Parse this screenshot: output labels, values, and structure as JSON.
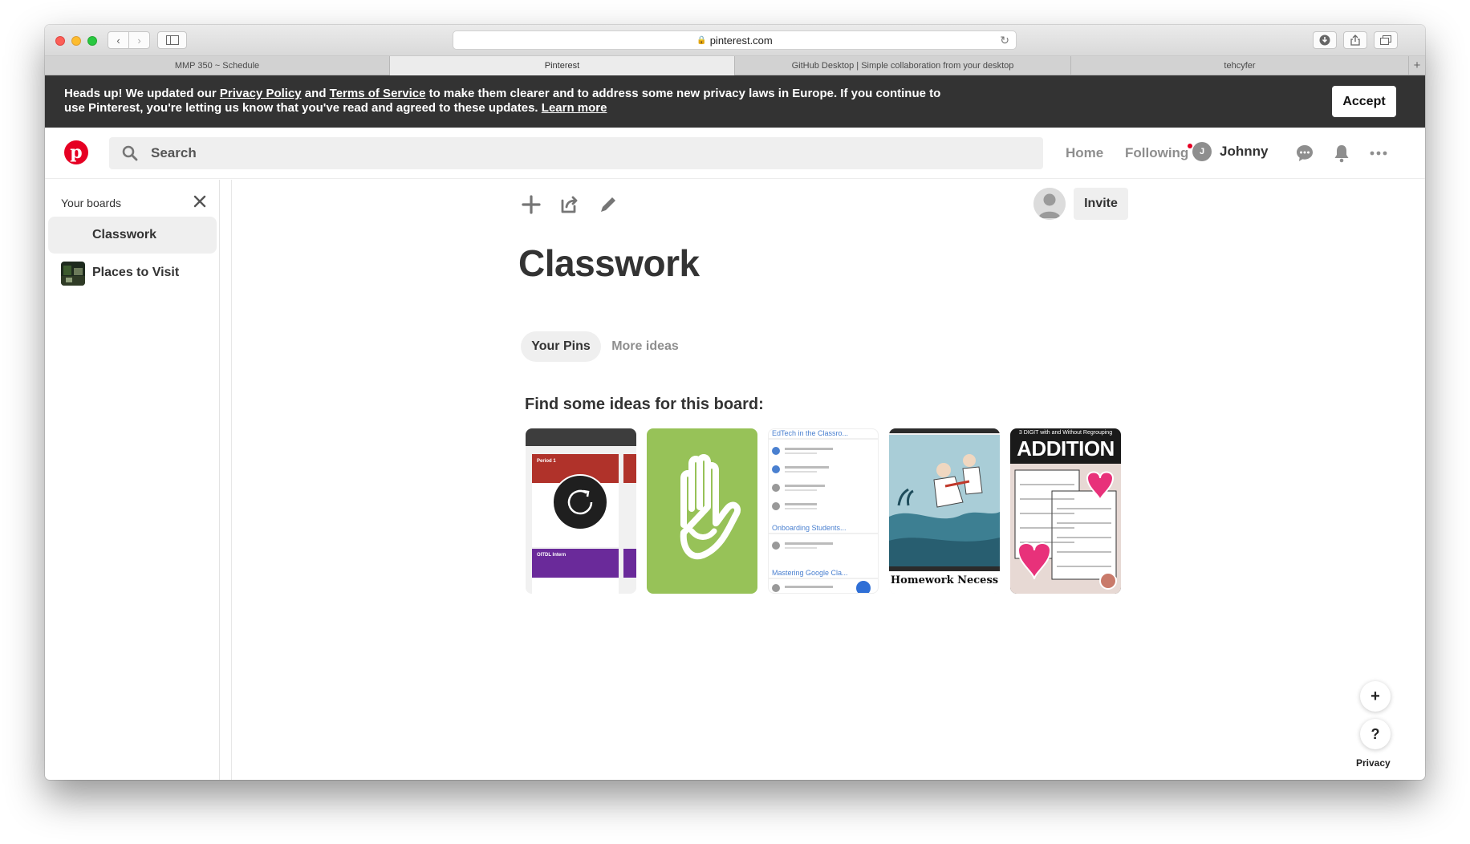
{
  "browser": {
    "url": "pinterest.com",
    "tabs": [
      {
        "label": "MMP 350 ~ Schedule",
        "active": false
      },
      {
        "label": "Pinterest",
        "active": true
      },
      {
        "label": "GitHub Desktop | Simple collaboration from your desktop",
        "active": false
      },
      {
        "label": "tehcyfer",
        "active": false
      }
    ]
  },
  "banner": {
    "part1": "Heads up! We updated our ",
    "privacy_link": "Privacy Policy",
    "part2": " and ",
    "terms_link": "Terms of Service",
    "part3": " to make them clearer and to address some new privacy laws in Europe. If you continue to use Pinterest, you're letting us know that you've read and agreed to these updates. ",
    "learn_more": "Learn more",
    "accept_label": "Accept"
  },
  "header": {
    "search_placeholder": "Search",
    "home_label": "Home",
    "following_label": "Following",
    "user_initial": "J",
    "user_name": "Johnny"
  },
  "sidebar": {
    "title": "Your boards",
    "boards": [
      {
        "label": "Classwork",
        "active": true
      },
      {
        "label": "Places to Visit",
        "active": false
      }
    ]
  },
  "board": {
    "invite_label": "Invite",
    "title": "Classwork",
    "tabs": [
      {
        "label": "Your Pins",
        "active": true
      },
      {
        "label": "More ideas",
        "active": false
      }
    ],
    "ideas_heading": "Find some ideas for this board:",
    "ideas": [
      {
        "card1_tile1": "Period 1",
        "card1_tile2": "OITDL Intern"
      },
      {
        "icon": "hand-icon"
      },
      {
        "title": "EdTech in the Classro...",
        "section2": "Onboarding Students...",
        "section3": "Mastering Google Cla..."
      },
      {
        "caption": "Homework Necess"
      },
      {
        "title": "ADDITION",
        "subtitle": "3 DIGIT with and Without Regrouping"
      }
    ]
  },
  "footer": {
    "privacy_label": "Privacy"
  },
  "colors": {
    "brand_red": "#e60023",
    "banner_bg": "#333333",
    "idea_green": "#97c258"
  }
}
